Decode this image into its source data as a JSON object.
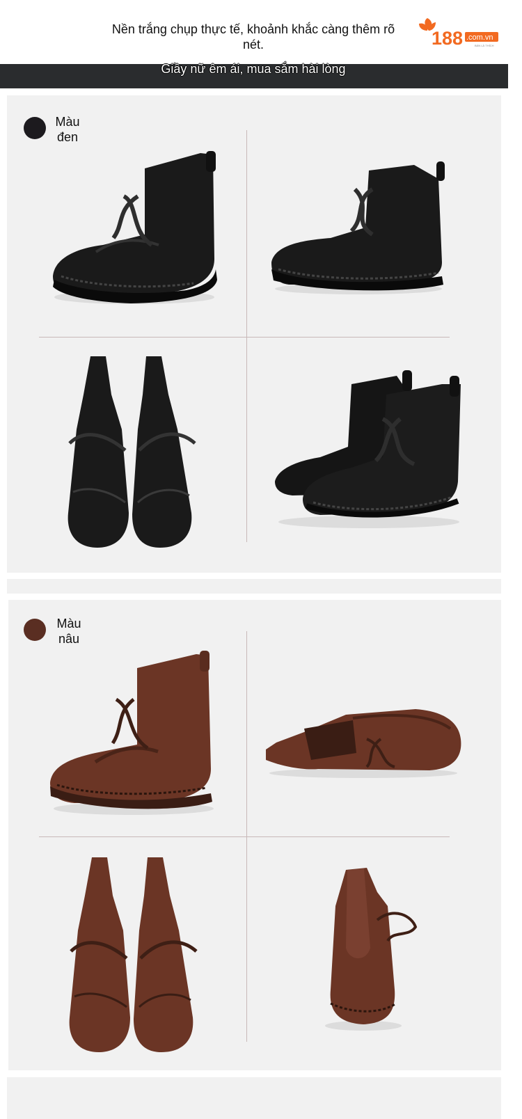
{
  "header": {
    "title": "Nền trắng chụp thực tế, khoảnh khắc càng thêm rõ nét.",
    "logo_number": "188",
    "logo_domain": ".com.vn",
    "logo_tagline": "BÁN LÀ THÍCH"
  },
  "banner": {
    "text": "Giầy nữ êm ái, mua sắm hài lòng"
  },
  "sections": [
    {
      "color_name": "Màu đen",
      "swatch_color": "#1c1a1e"
    },
    {
      "color_name": "Màu nâu",
      "swatch_color": "#5a2e22"
    }
  ],
  "colors": {
    "brand_orange": "#f26a21",
    "banner_bg": "#2a2c2e",
    "panel_bg": "#f1f1f1"
  },
  "images": [
    "black-boot-side-view",
    "black-boot-side-view-2",
    "black-boot-pair-front-view",
    "black-boot-pair-angled-view",
    "brown-boot-side-view",
    "brown-boot-sole-view",
    "brown-boot-pair-front-view",
    "brown-boot-back-view"
  ]
}
